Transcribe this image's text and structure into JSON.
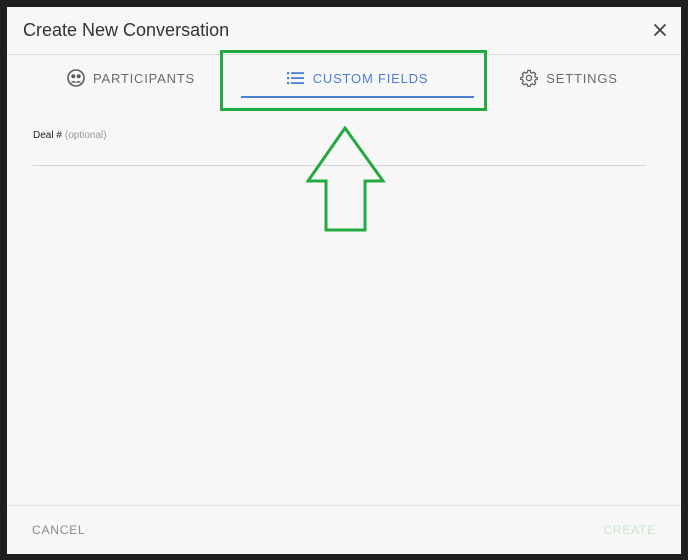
{
  "dialog": {
    "title": "Create New Conversation",
    "close_icon": "close-icon"
  },
  "tabs": [
    {
      "label": "PARTICIPANTS",
      "icon": "participants-icon",
      "active": false
    },
    {
      "label": "CUSTOM FIELDS",
      "icon": "list-icon",
      "active": true
    },
    {
      "label": "SETTINGS",
      "icon": "gear-icon",
      "active": false
    }
  ],
  "form": {
    "deal_field": {
      "label": "Deal #",
      "optional_text": "(optional)",
      "value": ""
    }
  },
  "footer": {
    "cancel_label": "CANCEL",
    "create_label": "CREATE"
  },
  "colors": {
    "accent": "#4a7fd4",
    "annotation": "#22a93f",
    "create_disabled": "#c4e7cd"
  }
}
